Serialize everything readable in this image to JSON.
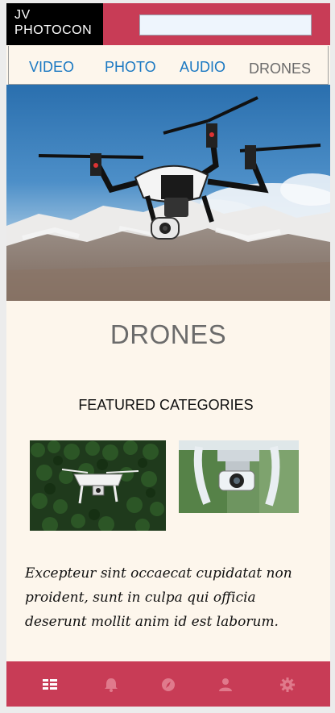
{
  "header": {
    "logo_line1": "JV",
    "logo_line2": "PHOTOCON",
    "search_value": ""
  },
  "tabs": [
    {
      "label": "VIDEO",
      "active": false
    },
    {
      "label": "PHOTO",
      "active": false
    },
    {
      "label": "AUDIO",
      "active": false
    },
    {
      "label": "DRONES",
      "active": true
    }
  ],
  "main": {
    "title": "DRONES",
    "section_heading": "FEATURED CATEGORIES",
    "description": "Excepteur sint occaecat cupidatat non proident, sunt in culpa qui officia deserunt mollit anim id est laborum."
  },
  "bottom_nav": {
    "items": [
      {
        "icon": "list-icon",
        "active": true
      },
      {
        "icon": "bell-icon",
        "active": false
      },
      {
        "icon": "compass-icon",
        "active": false
      },
      {
        "icon": "user-icon",
        "active": false
      },
      {
        "icon": "gear-icon",
        "active": false
      }
    ]
  },
  "colors": {
    "brand": "#c83c56",
    "background": "#fdf6ec",
    "tab_link": "#1a78c2",
    "tab_active": "#6b6b6b",
    "nav_icon_inactive": "#e07a8c",
    "nav_icon_active": "#ffffff"
  }
}
